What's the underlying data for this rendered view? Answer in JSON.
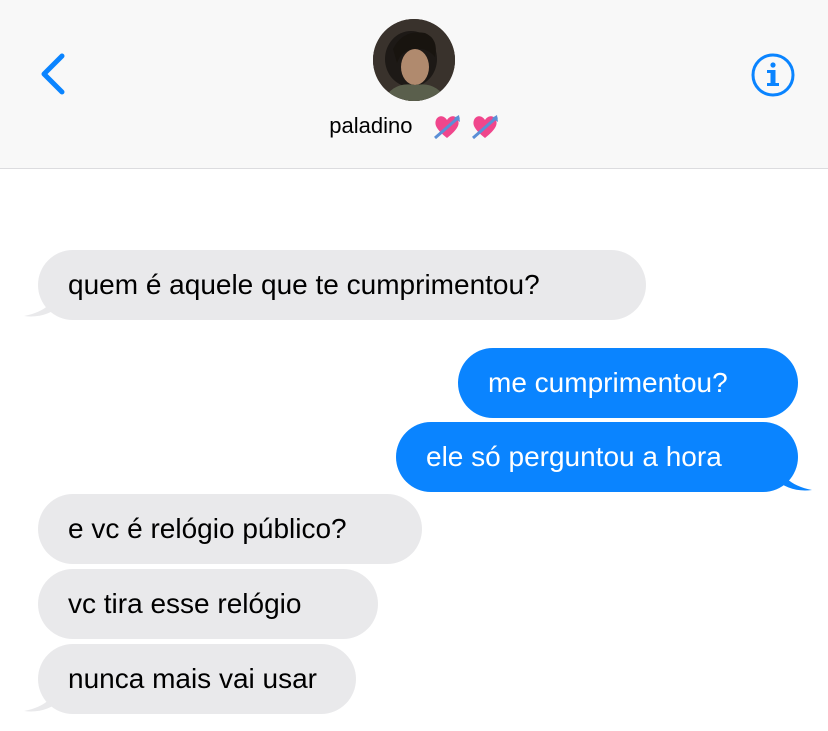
{
  "header": {
    "back_icon": "chevron-left-icon",
    "info_icon": "info-circle-icon",
    "contact_name": "paladino",
    "contact_emoji": "💘💘",
    "accent_color": "#0a84ff"
  },
  "messages": [
    {
      "direction": "received",
      "text": "quem é aquele que te cumprimentou?",
      "tail": true
    },
    {
      "direction": "sent",
      "text": "me cumprimentou?",
      "tail": false
    },
    {
      "direction": "sent",
      "text": "ele só perguntou a hora",
      "tail": true
    },
    {
      "direction": "received",
      "text": "e vc é relógio público?",
      "tail": false
    },
    {
      "direction": "received",
      "text": "vc tira esse relógio",
      "tail": false
    },
    {
      "direction": "received",
      "text": "nunca mais vai usar",
      "tail": true
    }
  ],
  "colors": {
    "sent_bubble": "#0a84ff",
    "received_bubble": "#e9e9eb",
    "header_bg": "#f8f8f8"
  }
}
